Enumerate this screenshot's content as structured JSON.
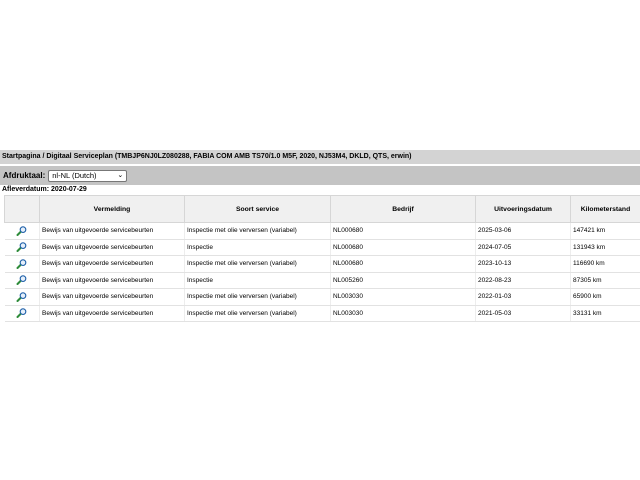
{
  "breadcrumb": "Startpagina / Digitaal Serviceplan (TMBJP6NJ0LZ080288, FABIA COM AMB TS70/1.0 M5F, 2020, NJ53M4, DKLD, QTS, erwin)",
  "language": {
    "label": "Afdruktaal:",
    "selected": "nl-NL (Dutch)"
  },
  "delivery_date": "Afleverdatum: 2020-07-29",
  "table": {
    "headers": {
      "description": "Vermelding",
      "service_type": "Soort service",
      "company": "Bedrijf",
      "date": "Uitvoeringsdatum",
      "mileage": "Kilometerstand"
    },
    "rows": [
      {
        "description": "Bewijs van uitgevoerde servicebeurten",
        "service_type": "Inspectie met olie verversen (variabel)",
        "company": "NL000680",
        "date": "2025-03-06",
        "mileage": "147421 km"
      },
      {
        "description": "Bewijs van uitgevoerde servicebeurten",
        "service_type": "Inspectie",
        "company": "NL000680",
        "date": "2024-07-05",
        "mileage": "131943 km"
      },
      {
        "description": "Bewijs van uitgevoerde servicebeurten",
        "service_type": "Inspectie met olie verversen (variabel)",
        "company": "NL000680",
        "date": "2023-10-13",
        "mileage": "116690 km"
      },
      {
        "description": "Bewijs van uitgevoerde servicebeurten",
        "service_type": "Inspectie",
        "company": "NL005260",
        "date": "2022-08-23",
        "mileage": "87305 km"
      },
      {
        "description": "Bewijs van uitgevoerde servicebeurten",
        "service_type": "Inspectie met olie verversen (variabel)",
        "company": "NL003030",
        "date": "2022-01-03",
        "mileage": "65900 km"
      },
      {
        "description": "Bewijs van uitgevoerde servicebeurten",
        "service_type": "Inspectie met olie verversen (variabel)",
        "company": "NL003030",
        "date": "2021-05-03",
        "mileage": "33131 km"
      }
    ]
  },
  "icons": {
    "row_detail": "magnifier-icon",
    "dropdown": "chevron-down-icon"
  },
  "colors": {
    "header_bar": "#d3d3d3",
    "language_bar": "#c4c4c4",
    "magnifier_handle": "#2e8b3a",
    "magnifier_lens": "#1d5fa8"
  }
}
